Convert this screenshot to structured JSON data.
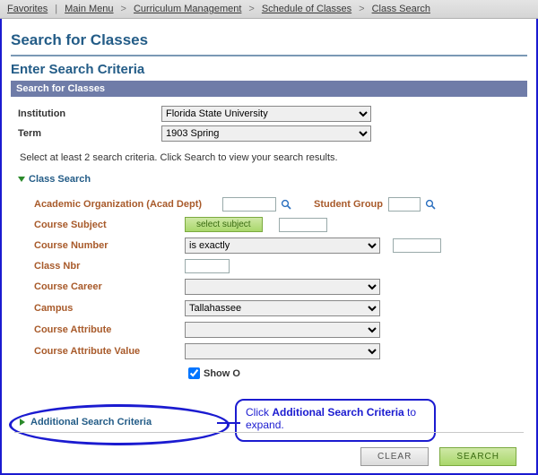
{
  "breadcrumb": {
    "items": [
      "Favorites",
      "Main Menu",
      "Curriculum Management",
      "Schedule of Classes",
      "Class Search"
    ]
  },
  "headings": {
    "page": "Search for Classes",
    "section": "Enter Search Criteria",
    "bar": "Search for Classes"
  },
  "top": {
    "institution_label": "Institution",
    "institution_value": "Florida State University",
    "term_label": "Term",
    "term_value": "1903 Spring"
  },
  "hint": "Select at least 2 search criteria. Click Search to view your search results.",
  "classSearch": {
    "header": "Class Search",
    "acad_org_label": "Academic Organization (Acad Dept)",
    "student_group_label": "Student Group",
    "course_subject_label": "Course Subject",
    "select_subject_btn": "select subject",
    "course_number_label": "Course Number",
    "course_number_op": "is exactly",
    "class_nbr_label": "Class Nbr",
    "course_career_label": "Course Career",
    "campus_label": "Campus",
    "campus_value": "Tallahassee",
    "course_attribute_label": "Course Attribute",
    "course_attr_value_label": "Course Attribute Value",
    "show_open_label": "Show O"
  },
  "additional": {
    "label": "Additional Search Criteria"
  },
  "callout": {
    "pre": "Click ",
    "bold": "Additional Search Criteria",
    "post": " to expand."
  },
  "buttons": {
    "clear": "CLEAR",
    "search": "SEARCH"
  }
}
